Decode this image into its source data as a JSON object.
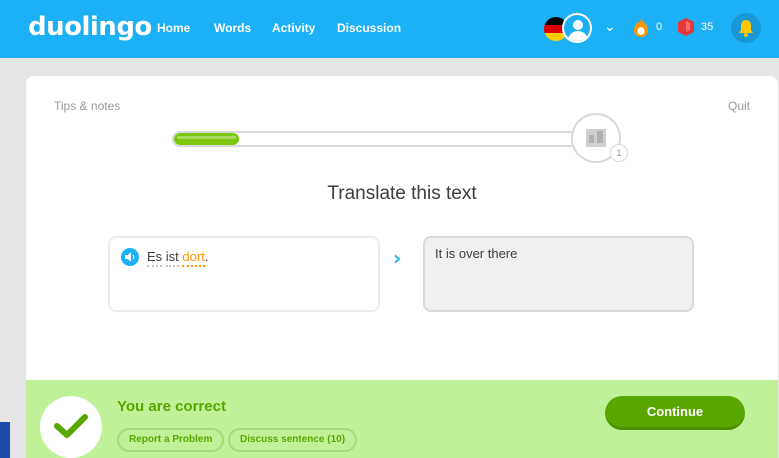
{
  "header": {
    "logo": "duolingo",
    "nav": [
      "Home",
      "Words",
      "Activity",
      "Discussion"
    ],
    "streak_count": "0",
    "lingots_count": "35",
    "icons": [
      "germany-flag-icon",
      "avatar-icon",
      "chevron-down-icon",
      "flame-icon",
      "gem-icon",
      "bell-icon"
    ]
  },
  "lesson": {
    "tips_label": "Tips & notes",
    "quit_label": "Quit",
    "progress_fraction": 0.16,
    "checkpoint_number": "1",
    "prompt": "Translate this text",
    "source_words": [
      {
        "text": "Es",
        "new": false
      },
      {
        "text": "ist",
        "new": false
      },
      {
        "text": "dort",
        "new": true
      }
    ],
    "source_punct": ".",
    "answer": "It is over there"
  },
  "result": {
    "title": "You are correct",
    "report_label": "Report a Problem",
    "discuss_label": "Discuss sentence (10)",
    "continue_label": "Continue"
  },
  "colors": {
    "brand_blue": "#1cb0f6",
    "correct_green": "#58a700",
    "footer_bg": "#bff199",
    "new_word_orange": "#ff9600"
  }
}
